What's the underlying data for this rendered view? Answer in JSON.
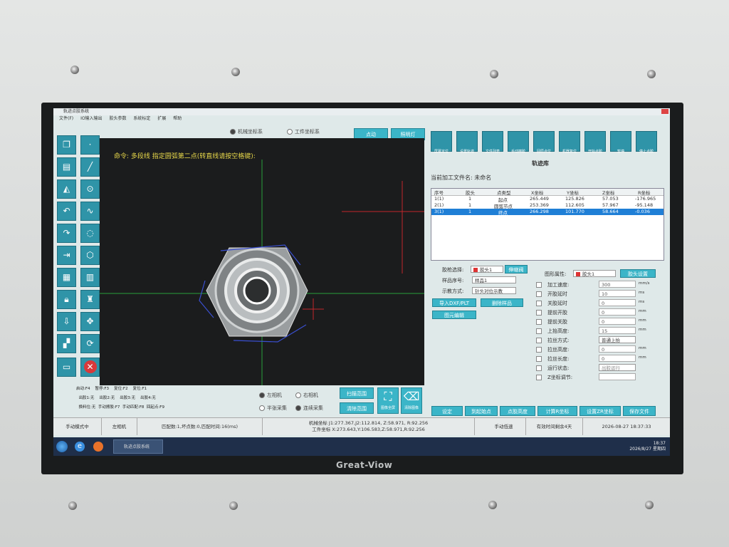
{
  "app": {
    "title": "轨迹点胶系统",
    "menu": [
      "文件(F)",
      "IO输入输出",
      "胶头参数",
      "系统标定",
      "扩展",
      "帮助"
    ]
  },
  "coord": {
    "machine": "机械坐标系",
    "work": "工件坐标系"
  },
  "top_buttons": {
    "spot": "点动",
    "light": "照明灯"
  },
  "command_prompt": "命令: 多段线 指定圆弧第二点(转直线请按空格键):",
  "left_tools": [
    "copy-icon",
    "point-icon",
    "folder-icon",
    "line-icon",
    "mirror-icon",
    "circle-center-icon",
    "undo-icon",
    "polyline-icon",
    "redo-icon",
    "circle-icon",
    "split-icon",
    "hexagon-icon",
    "grid-icon",
    "ruler-icon",
    "lock-icon",
    "stamp-icon",
    "pin-icon",
    "move-icon",
    "array-icon",
    "refresh-icon",
    "film-icon",
    "delete-icon"
  ],
  "hotkeys": {
    "row1": [
      "启动:F4",
      "暂停:F3",
      "复位:F2",
      "复位:F1"
    ],
    "row2": [
      "出胶1:无",
      "出胶2:无",
      "出胶3:无",
      "出胶4:无"
    ],
    "row3": [
      "换料位:无",
      "手动擦胶:F7",
      "手动匹配:F8",
      "回起点:F9"
    ]
  },
  "camera": {
    "left": "左相机",
    "right": "右相机",
    "semi": "半张采集",
    "continuous": "连续采集"
  },
  "scan": {
    "scan_range": "扫描范围",
    "clear_range": "清除范围",
    "fullscreen": "图像全屏",
    "clear_img": "清除图像"
  },
  "right_tools": [
    "屏幕定位",
    "设置轨迹",
    "文件列表",
    "手动擦胶",
    "回原点位",
    "机器复位",
    "开始点胶",
    "暂停",
    "停止点胶"
  ],
  "track_lib": "轨迹库",
  "current_file": {
    "label": "当前加工文件名:",
    "value": "未命名"
  },
  "table": {
    "headers": [
      "序号",
      "胶头",
      "点类型",
      "X坐标",
      "Y坐标",
      "Z坐标",
      "R坐标"
    ],
    "rows": [
      [
        "1(1)",
        "1",
        "起点",
        "265.449",
        "125.826",
        "57.053",
        "-176.965"
      ],
      [
        "2(1)",
        "1",
        "圆弧节点",
        "253.369",
        "112.605",
        "57.967",
        "-95.148"
      ],
      [
        "3(1)",
        "1",
        "终点",
        "266.298",
        "101.770",
        "58.664",
        "-0.036"
      ]
    ],
    "selected_row": 2
  },
  "params_left": {
    "glue_label": "胶枪选择:",
    "glue_value": "胶头1",
    "stretch": "伸缩阀",
    "sample_label": "样品序号:",
    "sample_value": "样品1",
    "teach_label": "示教方式:",
    "teach_value": "针头对位示教",
    "import_btn": "导入DXF/PLT",
    "delete_btn": "删除样品",
    "edit_btn": "图元编辑"
  },
  "params_right": {
    "shape_label": "图形属性:",
    "shape_value": "胶头1",
    "glue_set": "胶头设置",
    "fields": [
      {
        "label": "加工速度:",
        "value": "300",
        "unit": "mm/s"
      },
      {
        "label": "开胶延时",
        "value": "10",
        "unit": "ms"
      },
      {
        "label": "关胶延时",
        "value": "0",
        "unit": "ms"
      },
      {
        "label": "提前开胶",
        "value": "0",
        "unit": "mm"
      },
      {
        "label": "提前关胶",
        "value": "0",
        "unit": "mm"
      },
      {
        "label": "上抬高度:",
        "value": "15",
        "unit": "mm"
      },
      {
        "label": "拉丝方式:",
        "value": "普通上抬",
        "unit": ""
      },
      {
        "label": "拉丝高度:",
        "value": "0",
        "unit": "mm"
      },
      {
        "label": "拉丝长度:",
        "value": "0",
        "unit": "mm"
      },
      {
        "label": "运行状态:",
        "value": "出胶运行",
        "unit": ""
      },
      {
        "label": "Z坐标调节:",
        "value": "",
        "unit": ""
      }
    ]
  },
  "bottom_buttons": [
    "设定",
    "到起始点",
    "点胶高度",
    "计算R坐标",
    "设置ZR坐标",
    "保存文件"
  ],
  "status": {
    "mode": "手动模式中",
    "camera": "左相机",
    "match": "匹配数:1,坏点数:0,匹配时间:16(ms)",
    "mech_coord": "机械坐标 J1:277.367,J2:112.814, Z:58.971, R:92.256",
    "work_coord": "工件坐标 X:273.643,Y:106.583,Z:58.971,R:92.256",
    "speed": "手动低速",
    "valid": "有效时间剩余4天",
    "datetime": "2026-08-27 18:37:33"
  },
  "taskbar": {
    "app_title": "轨迹点胶系统",
    "time": "18:37",
    "date": "2026/8/27 星期四"
  },
  "monitor_brand": "Great-Viow"
}
